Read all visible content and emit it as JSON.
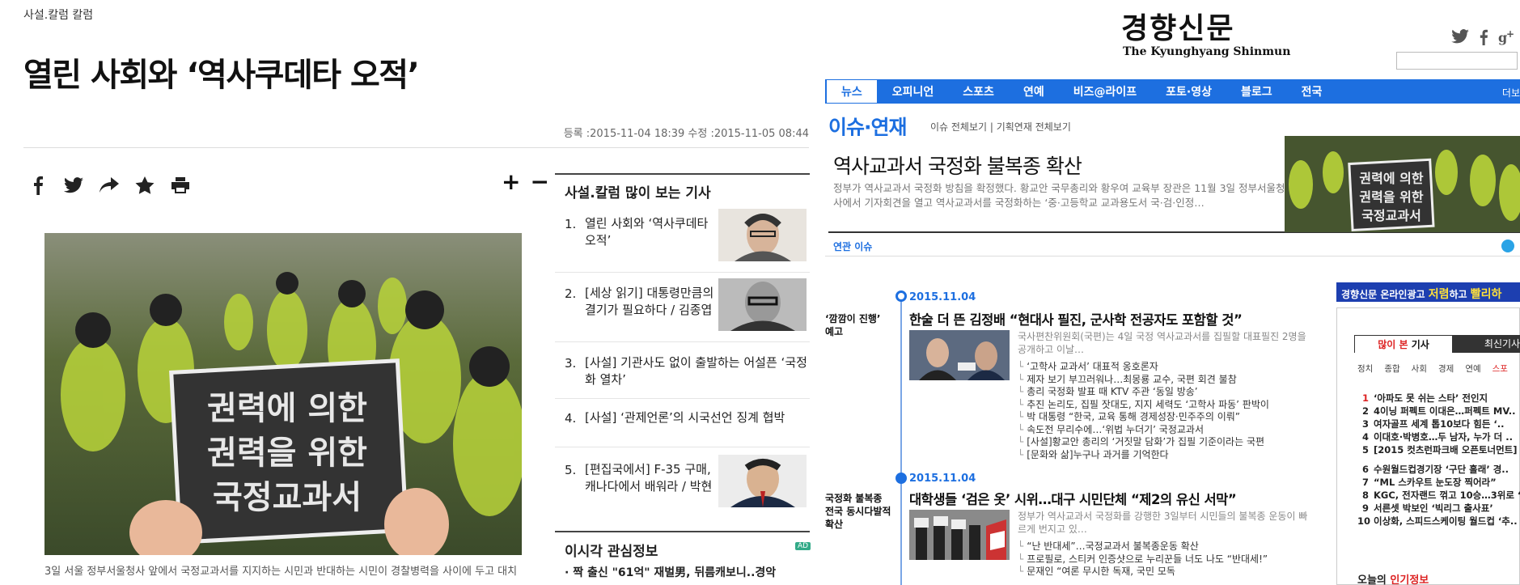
{
  "left": {
    "category": "사설.칼럼 칼럼",
    "headline": "열린 사회와 ‘역사쿠데타 오적’",
    "dates": "등록 :2015-11-04 18:39   수정 :2015-11-05 08:44",
    "zoom": {
      "plus": "+",
      "minus": "−"
    },
    "photo_sign": [
      "권력에 의한",
      "권력을 위한",
      "국정교과서"
    ],
    "caption": "3일 서울 정부서울청사 앞에서 국정교과서를 지지하는 시민과 반대하는 시민이 경찰병력을 사이에 두고 대치",
    "sidebar": {
      "title": "사설.칼럼 많이 보는 기사",
      "items": [
        {
          "num": "1.",
          "text": "열린 사회와 ‘역사쿠데타 오적’"
        },
        {
          "num": "2.",
          "text": "[세상 읽기] 대통령만큼의 결기가 필요하다 / 김종엽"
        },
        {
          "num": "3.",
          "text": "[사설] 기관사도 없이 출발하는 어설픈 ‘국정화 열차’"
        },
        {
          "num": "4.",
          "text": "[사설] ‘관제언론’의 시국선언 징계 협박"
        },
        {
          "num": "5.",
          "text": "[편집국에서] F-35 구매, 캐나다에서 배워라 / 박현"
        }
      ]
    },
    "info": {
      "title": "이시각 관심정보",
      "ad": "AD",
      "item": "· 짝 출신 \"61억\" 재벌男, 뒤름캐보니..경악"
    }
  },
  "right": {
    "logo_ko": "경향신문",
    "logo_en": "The Kyunghyang Shinmun",
    "nav": [
      "뉴스",
      "오피니언",
      "스포츠",
      "연예",
      "비즈@라이프",
      "포토·영상",
      "블로그",
      "전국"
    ],
    "nav_more": "더보",
    "issue_heading": "이슈·연재",
    "issue_links": "이슈 전체보기  |  기획연재 전체보기",
    "feature": {
      "title": "역사교과서 국정화 불복종 확산",
      "desc": "정부가 역사교과서 국정화 방침을 확정했다. 황교안 국무총리와 황우여 교육부 장관은 11월 3일 정부서울청사에서 기자회견을 열고 역사교과서를 국정화하는 ‘중·고등학교 교과용도서 국·검·인정…",
      "sign": [
        "권력에 의한",
        "권력을 위한",
        "국정교과서"
      ]
    },
    "related": "연관 이슈",
    "timeline": [
      {
        "date": "2015.11.04",
        "tag": "‘깜깜이 진행’ 예고",
        "title": "한술 더 뜬 김정배 “현대사 필진, 군사학 전공자도 포함할 것”",
        "desc": "국사편찬위원회(국편)는 4일 국정 역사교과서를 집필할 대표필진 2명을 공개하고 이날…",
        "subs": [
          "‘고학사 교과서’ 대표적 옹호론자",
          "제자 보기 부끄러워나…최몽룡 교수, 국편 회견 불참",
          "총리 국정화 발표 때 KTV 주관 ‘동일 방송’",
          "추진 논리도, 집필 잣대도, 지지 세력도 ‘고학사 파동’ 판박이",
          "박 대통령 “한국, 교육 통해 경제성장·민주주의 이뤄”",
          "속도전 무리수에…‘위법 누더기’ 국정교과서",
          "[사설]황교안 총리의 ‘거짓말 담화’가 집필 기준이라는 국편",
          "[문화와 삶]누구나 과거를 기억한다"
        ]
      },
      {
        "date": "2015.11.04",
        "tag": "국정화 불복종 전국 동시다발적 확산",
        "title": "대학생들 ‘검은 옷’ 시위…대구 시민단체 “제2의 유신 서막”",
        "desc": "정부가 역사교과서 국정화를 강행한 3일부터 시민들의 불복종 운동이 빠르게 번지고 있…",
        "subs": [
          "“난 반대세”…국정교과서 불복종운동 확산",
          "프로필로, 스티커 인증샷으로 누리꾼들 너도 나도 “반대세!”",
          "문재인 “여론 무시한 독재, 국민 모독"
        ]
      }
    ],
    "ad_banner": {
      "prefix": "경향신문 온라인광고",
      "hl1": "저렴",
      "mid": "하고",
      "hl2": "빨리하"
    },
    "popular": {
      "tab_on_a": "많이 본",
      "tab_on_b": " 기사",
      "tab_off": "최신기사",
      "cats": [
        "정치",
        "종합",
        "사회",
        "경제",
        "연예",
        "스포"
      ],
      "items": [
        {
          "n": "1",
          "t": "‘아파도 못 쉬는 스타’ 전인지"
        },
        {
          "n": "2",
          "t": "4이닝 퍼펙트 이대은…퍼펙트 MV.."
        },
        {
          "n": "3",
          "t": "여자골프 세계 톱10보다 힘든 ‘.."
        },
        {
          "n": "4",
          "t": "이대호·박병호…두 남자, 누가 더 .."
        },
        {
          "n": "5",
          "t": "[2015 컷츠런파크배 오픈토너먼트] .."
        },
        {
          "n": "6",
          "t": "수원월드컵경기장 ‘구단 홀래’ 경.."
        },
        {
          "n": "7",
          "t": "“ML 스카우트 눈도장 찍어라”"
        },
        {
          "n": "8",
          "t": "KGC, 전자랜드 꺾고 10승…3위로 ‘.."
        },
        {
          "n": "9",
          "t": "서른셋 박보인 ‘빅리그 출사표’"
        },
        {
          "n": "10",
          "t": "이상화, 스피드스케이팅 월드컵 ‘추.."
        }
      ],
      "today_a": "오늘의 ",
      "today_b": "인기정보"
    }
  }
}
